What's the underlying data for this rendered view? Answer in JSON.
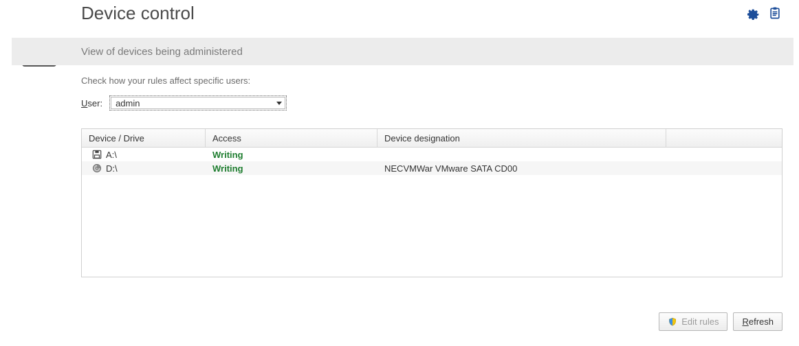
{
  "header": {
    "title": "Device control",
    "section": "View of devices being administered"
  },
  "content": {
    "hint": "Check how your rules affect specific users:",
    "user_label_prefix": "U",
    "user_label_rest": "ser:",
    "user_value": "admin"
  },
  "table": {
    "columns": {
      "device": "Device / Drive",
      "access": "Access",
      "designation": "Device designation"
    },
    "rows": [
      {
        "icon": "floppy",
        "device": "A:\\",
        "access": "Writing",
        "access_class": "writing",
        "designation": ""
      },
      {
        "icon": "disc",
        "device": "D:\\",
        "access": "Writing",
        "access_class": "writing",
        "designation": "NECVMWar VMware SATA CD00"
      }
    ]
  },
  "footer": {
    "edit_rules": "Edit rules",
    "refresh_prefix": "R",
    "refresh_rest": "efresh"
  },
  "colors": {
    "accent": "#1d4e9a",
    "access_ok": "#1e7d2f"
  }
}
